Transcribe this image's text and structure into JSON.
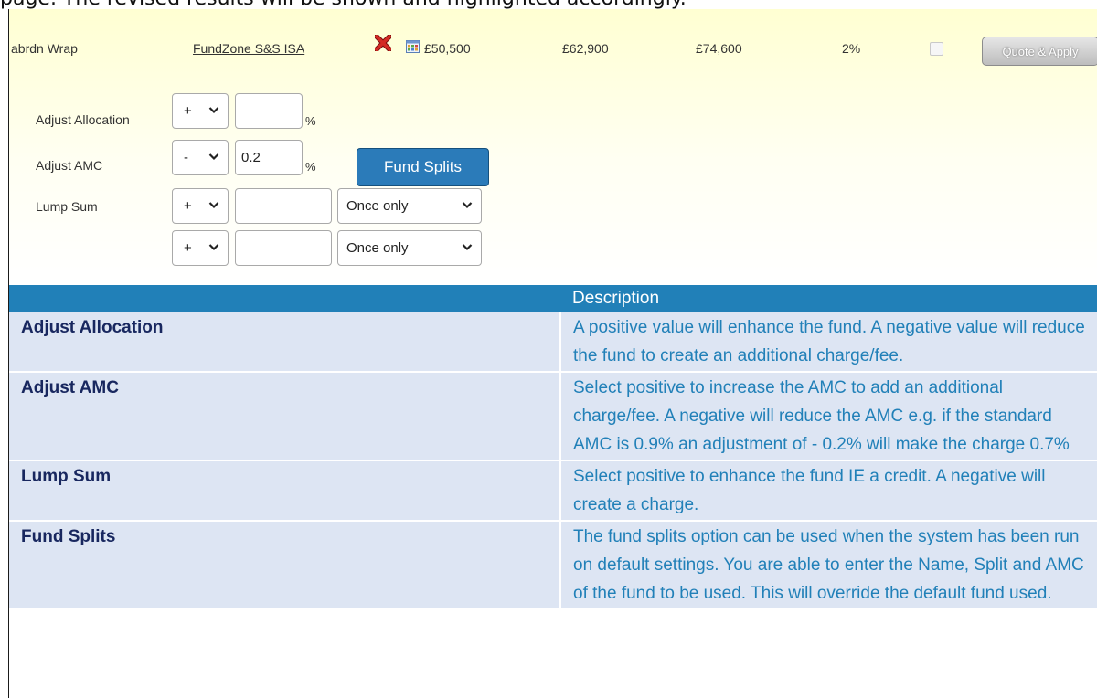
{
  "intro": {
    "text": "page. The revised results will be shown and highlighted accordingly."
  },
  "result_row": {
    "provider": "abrdn Wrap",
    "product": "FundZone S&S ISA",
    "delete_icon": "red-x-icon",
    "details_icon": "table-grid-icon",
    "values": [
      "£50,500",
      "£62,900",
      "£74,600"
    ],
    "percent": "2%",
    "quote_apply_label": "Quote & Apply"
  },
  "adjustments": {
    "allocation": {
      "label": "Adjust Allocation",
      "sign": "+",
      "value": "",
      "unit": "%"
    },
    "amc": {
      "label": "Adjust AMC",
      "sign": "-",
      "value": "0.2",
      "unit": "%"
    },
    "fund_splits_label": "Fund Splits",
    "lump_sum": {
      "label": "Lump Sum",
      "rows": [
        {
          "sign": "+",
          "value": "",
          "frequency": "Once only"
        },
        {
          "sign": "+",
          "value": "",
          "frequency": "Once only"
        }
      ]
    }
  },
  "description_table": {
    "header_term": "",
    "header_description": "Description",
    "rows": [
      {
        "term": "Adjust Allocation",
        "description": "A positive value will enhance the fund. A negative value will reduce the fund to create an additional charge/fee."
      },
      {
        "term": "Adjust AMC",
        "description": "Select positive to increase the AMC to add an additional charge/fee. A negative will reduce the AMC e.g. if the standard AMC is 0.9% an adjustment of - 0.2% will make the charge 0.7%"
      },
      {
        "term": "Lump Sum",
        "description": "Select positive to enhance the fund IE a credit. A negative will create a charge."
      },
      {
        "term": "Fund Splits",
        "description": "The fund splits option can be used when the system has been run on default settings. You are able to enter the Name, Split and AMC of the fund to be used. This will override the default fund used."
      }
    ]
  },
  "colors": {
    "panel_top": "#ffffd2",
    "table_header": "#2180b8",
    "row_bg": "#dde5f3",
    "term_text": "#18275f",
    "desc_text": "#2180b8",
    "fund_splits_button": "#2b7bb9",
    "delete_icon": "#c8201e"
  }
}
